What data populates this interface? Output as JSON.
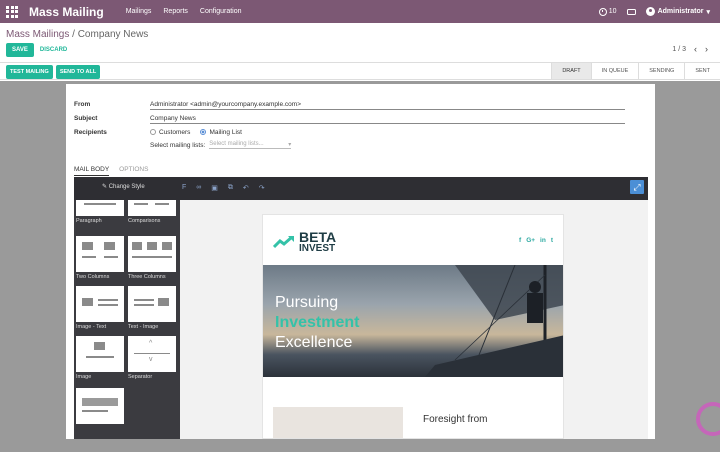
{
  "app": {
    "name": "Mass Mailing"
  },
  "nav": {
    "menu": [
      "Mailings",
      "Reports",
      "Configuration"
    ]
  },
  "systray": {
    "activity_count": "10",
    "user": "Administrator"
  },
  "breadcrumb": {
    "parent": "Mass Mailings",
    "separator": "/",
    "current": "Company News"
  },
  "actions": {
    "save": "SAVE",
    "discard": "DISCARD"
  },
  "pager": {
    "value": "1 / 3"
  },
  "header": {
    "buttons": [
      "TEST MAILING",
      "SEND TO ALL"
    ],
    "states": [
      {
        "label": "DRAFT",
        "active": true
      },
      {
        "label": "IN QUEUE",
        "active": false
      },
      {
        "label": "SENDING",
        "active": false
      },
      {
        "label": "SENT",
        "active": false
      }
    ]
  },
  "form": {
    "from_label": "From",
    "from_value": "Administrator <admin@yourcompany.example.com>",
    "subject_label": "Subject",
    "subject_value": "Company News",
    "recipients_label": "Recipients",
    "recipients_options": [
      "Customers",
      "Mailing List"
    ],
    "recipients_selected": "Mailing List",
    "mailing_lists_label": "Select mailing lists:",
    "mailing_lists_placeholder": "Select mailing lists..."
  },
  "tabs": [
    {
      "label": "MAIL BODY",
      "active": true
    },
    {
      "label": "OPTIONS",
      "active": false
    }
  ],
  "editor": {
    "change_style": "Change Style",
    "snippets": [
      "Paragraph",
      "Comparisons",
      "Two Columns",
      "Three Columns",
      "Image - Text",
      "Text - Image",
      "Image",
      "Separator"
    ]
  },
  "email": {
    "logo_line1": "BETA",
    "logo_line2": "INVEST",
    "social": [
      "f",
      "G+",
      "in",
      "t"
    ],
    "hero_line1": "Pursuing",
    "hero_line2": "Investment",
    "hero_line3": "Excellence",
    "section_title": "Foresight from"
  },
  "colors": {
    "topbar": "#7c5874",
    "primary_button": "#21b799",
    "accent": "#34c2a8",
    "expand_button": "#4b8fd6"
  }
}
